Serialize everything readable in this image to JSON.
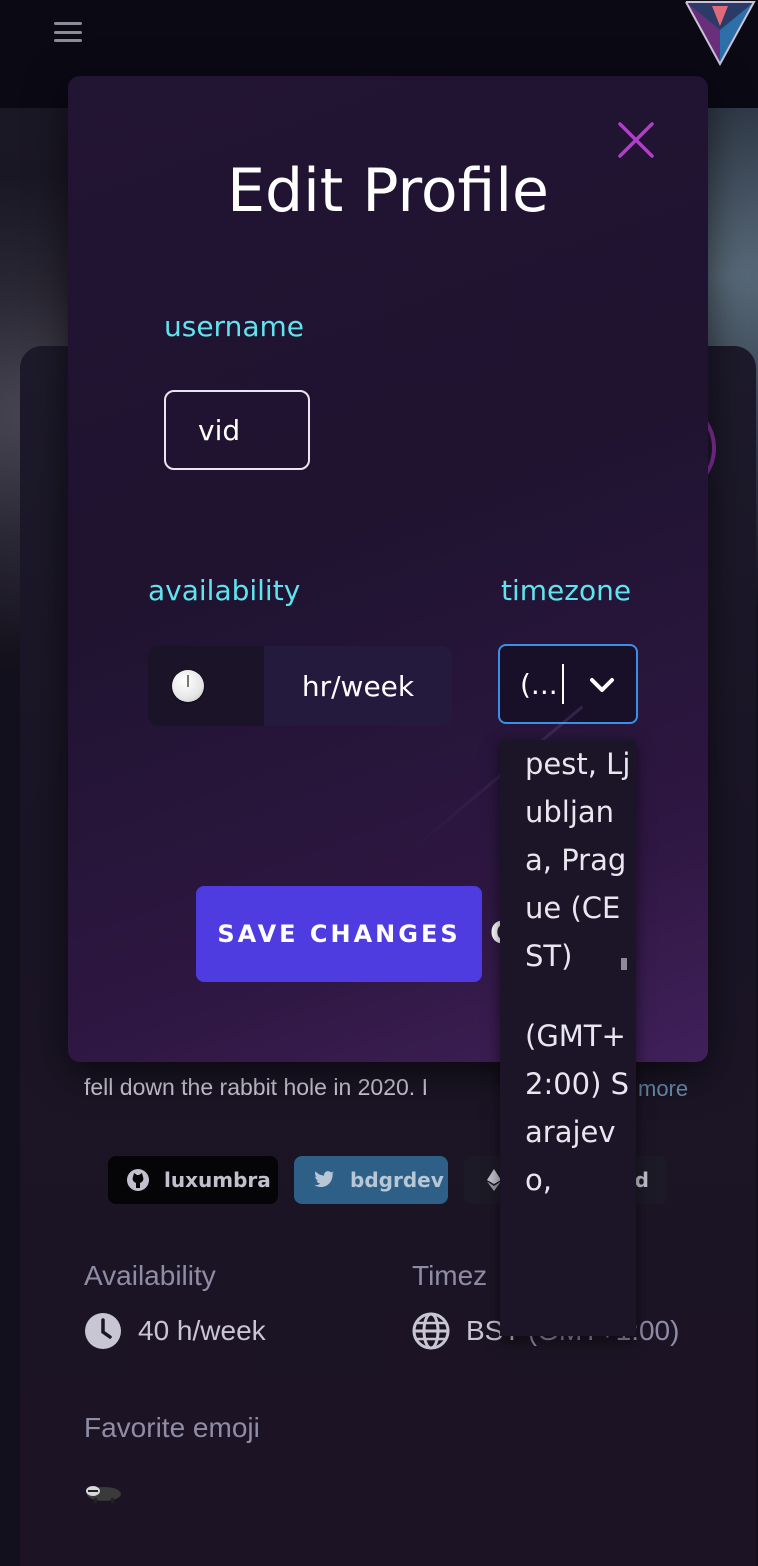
{
  "nav": {
    "menu_icon": "hamburger-icon",
    "logo_icon": "triangle-logo"
  },
  "profile": {
    "bio_line": "fell down the rabbit hole in 2020. I",
    "bio_more": "more",
    "socials": {
      "github": "luxumbra",
      "twitter": "bdgrdev",
      "eth_suffix": "fd"
    },
    "availability_label": "Availability",
    "availability_value": "40 h/week",
    "timezone_label": "Timez",
    "timezone_value": "BST",
    "timezone_muted": "(GMT+1:00)",
    "favorite_emoji_label": "Favorite emoji",
    "favorite_emoji_icon": "badger-emoji"
  },
  "modal": {
    "title": "Edit Profile",
    "close_icon": "close-x-icon",
    "username_label": "username",
    "username_value": "vid",
    "availability_label": "availability",
    "availability_suffix": "hr/week",
    "timezone_label": "timezone",
    "timezone_selected": "(...",
    "save_label": "SAVE CHANGES",
    "cancel_peek": "C"
  },
  "timezone_options": [
    "pest, Ljubljana, Prague (CEST)",
    "(GMT+2:00) Sarajevo,"
  ],
  "colors": {
    "accent_cyan": "#5fe3ee",
    "primary_button": "#4f3ce0",
    "close_icon": "#b03fc8",
    "select_border": "#3b8fe6"
  }
}
